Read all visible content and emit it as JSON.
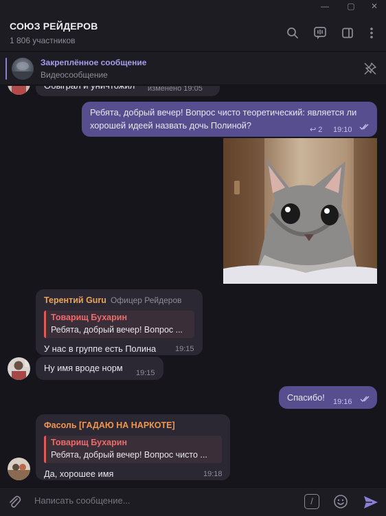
{
  "window": {
    "minimize_glyph": "—",
    "maximize_glyph": "▢",
    "close_glyph": "✕"
  },
  "header": {
    "title": "СОЮЗ РЕЙДЕРОВ",
    "subtitle": "1 806 участников",
    "icons": [
      "search-icon",
      "voice-chat-icon",
      "sidebar-icon",
      "more-icon"
    ]
  },
  "pinned": {
    "title": "Закреплённое сообщение",
    "text": "Видеосообщение"
  },
  "messages": {
    "m0": {
      "text": "Обыграл и уничтожил",
      "time": "изменено 19:05"
    },
    "m1": {
      "text": "Ребята, добрый вечер! Вопрос чисто теоретический: является ли хорошей идеей назвать дочь Полиной?",
      "replies": "2",
      "time": "19:10"
    },
    "m3": {
      "sender": "Терентий Guru",
      "tag": "Офицер Рейдеров",
      "reply_name": "Товарищ Бухарин",
      "reply_text": "Ребята, добрый вечер! Вопрос ...",
      "text": "У нас в группе есть Полина",
      "time": "19:15"
    },
    "m4": {
      "text": "Ну имя вроде норм",
      "time": "19:15"
    },
    "m5": {
      "text": "Спасибо!",
      "time": "19:16"
    },
    "m6": {
      "sender": "Фасоль [ГАДАЮ НА НАРКОТЕ]",
      "reply_name": "Товарищ Бухарин",
      "reply_text": "Ребята, добрый вечер! Вопрос чисто ...",
      "text": "Да, хорошее имя",
      "time": "19:18"
    }
  },
  "input": {
    "placeholder": "Написать сообщение...",
    "command_glyph": "/"
  },
  "colors": {
    "accent": "#8b7fd8",
    "outgoing": "#564e8f",
    "incoming": "#2b2833",
    "sender1": "#e8a55a",
    "sender2": "#f0964f",
    "reply_accent": "#e05a5a"
  }
}
